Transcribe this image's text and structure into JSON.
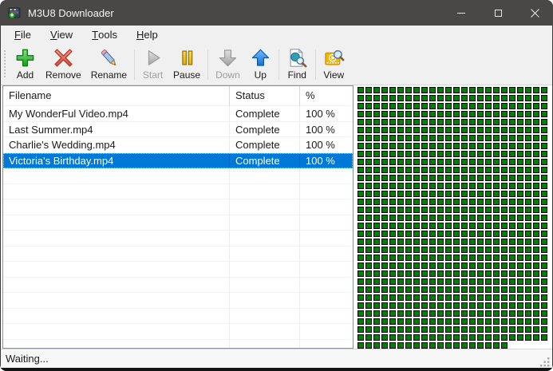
{
  "titlebar": {
    "title": "M3U8 Downloader",
    "minimize_label": "minimize",
    "maximize_label": "maximize",
    "close_label": "close"
  },
  "menubar": {
    "items": [
      "File",
      "View",
      "Tools",
      "Help"
    ]
  },
  "toolbar": {
    "buttons": [
      {
        "label": "Add",
        "icon": "add-icon",
        "enabled": true,
        "separator_before": false
      },
      {
        "label": "Remove",
        "icon": "remove-icon",
        "enabled": true,
        "separator_before": false
      },
      {
        "label": "Rename",
        "icon": "rename-icon",
        "enabled": true,
        "separator_before": false
      },
      {
        "label": "Start",
        "icon": "start-icon",
        "enabled": false,
        "separator_before": true
      },
      {
        "label": "Pause",
        "icon": "pause-icon",
        "enabled": true,
        "separator_before": false
      },
      {
        "label": "Down",
        "icon": "down-icon",
        "enabled": false,
        "separator_before": true
      },
      {
        "label": "Up",
        "icon": "up-icon",
        "enabled": true,
        "separator_before": false
      },
      {
        "label": "Find",
        "icon": "find-icon",
        "enabled": true,
        "separator_before": true
      },
      {
        "label": "View",
        "icon": "view-icon",
        "enabled": true,
        "separator_before": true
      }
    ]
  },
  "table": {
    "columns": [
      "Filename",
      "Status",
      "%"
    ],
    "rows": [
      {
        "filename": "My WonderFul Video.mp4",
        "status": "Complete",
        "percent": "100 %",
        "selected": false
      },
      {
        "filename": "Last Summer.mp4",
        "status": "Complete",
        "percent": "100 %",
        "selected": false
      },
      {
        "filename": "Charlie's Wedding.mp4",
        "status": "Complete",
        "percent": "100 %",
        "selected": false
      },
      {
        "filename": "Victoria's Birthday.mp4",
        "status": "Complete",
        "percent": "100 %",
        "selected": true
      }
    ],
    "empty_row_count": 12
  },
  "segments": {
    "total": 787,
    "columns": 24,
    "cell_color": "#008000"
  },
  "statusbar": {
    "text": "Waiting..."
  },
  "colors": {
    "selection": "#0078d7",
    "titlebar": "#4a4846",
    "segment_green": "#008000"
  }
}
